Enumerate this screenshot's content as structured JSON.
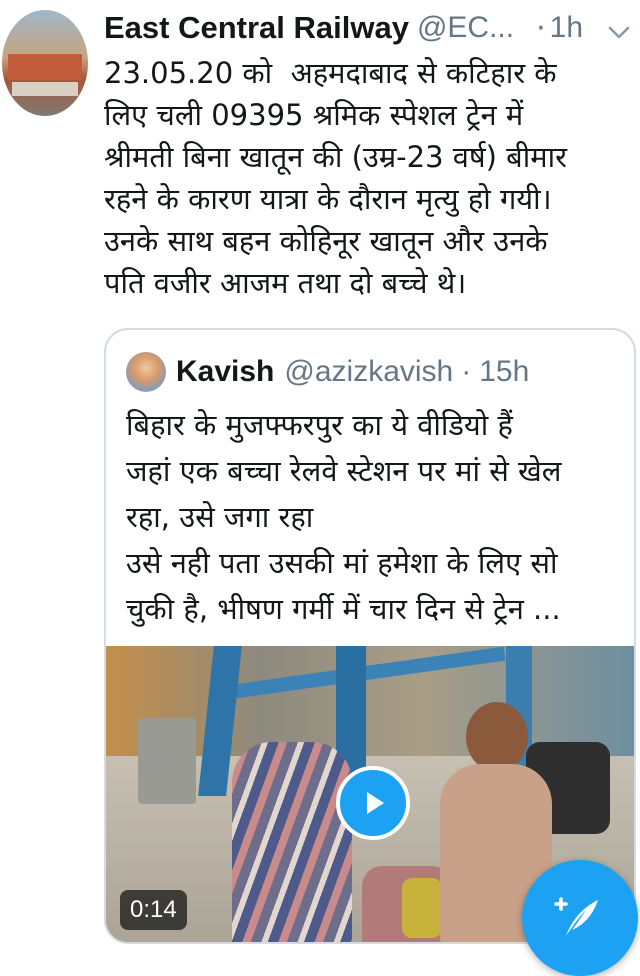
{
  "tweet": {
    "author_name": "East Central Railway",
    "author_handle": "@EC...",
    "separator": "·",
    "time": "1h",
    "text": "23.05.20 को  अहमदाबाद से कटिहार के\nलिए चली 09395 श्रमिक स्पेशल ट्रेन में\nश्रीमती बिना खातून की (उम्र-23 वर्ष) बीमार\nरहने के कारण यात्रा के दौरान मृत्यु हो गयी।\nउनके साथ बहन कोहिनूर खातून और उनके\nपति वजीर आजम तथा दो बच्चे थे।"
  },
  "quoted_tweet": {
    "author_name": "Kavish",
    "author_handle": "@azizkavish",
    "separator": "·",
    "time": "15h",
    "text": "बिहार के मुजफ्फरपुर का ये वीडियो हैं\nजहां एक बच्चा रेलवे स्टेशन पर मां से खेल\nरहा, उसे जगा रहा\nउसे नही पता उसकी मां हमेशा के लिए सो\nचुकी है, भीषण गर्मी में चार दिन से ट्रेन ...",
    "video": {
      "duration": "0:14",
      "icon": "play-icon"
    }
  },
  "fab": {
    "icon": "compose-tweet-icon"
  },
  "colors": {
    "accent": "#1da1f2",
    "muted": "#657786",
    "text": "#14171a"
  }
}
